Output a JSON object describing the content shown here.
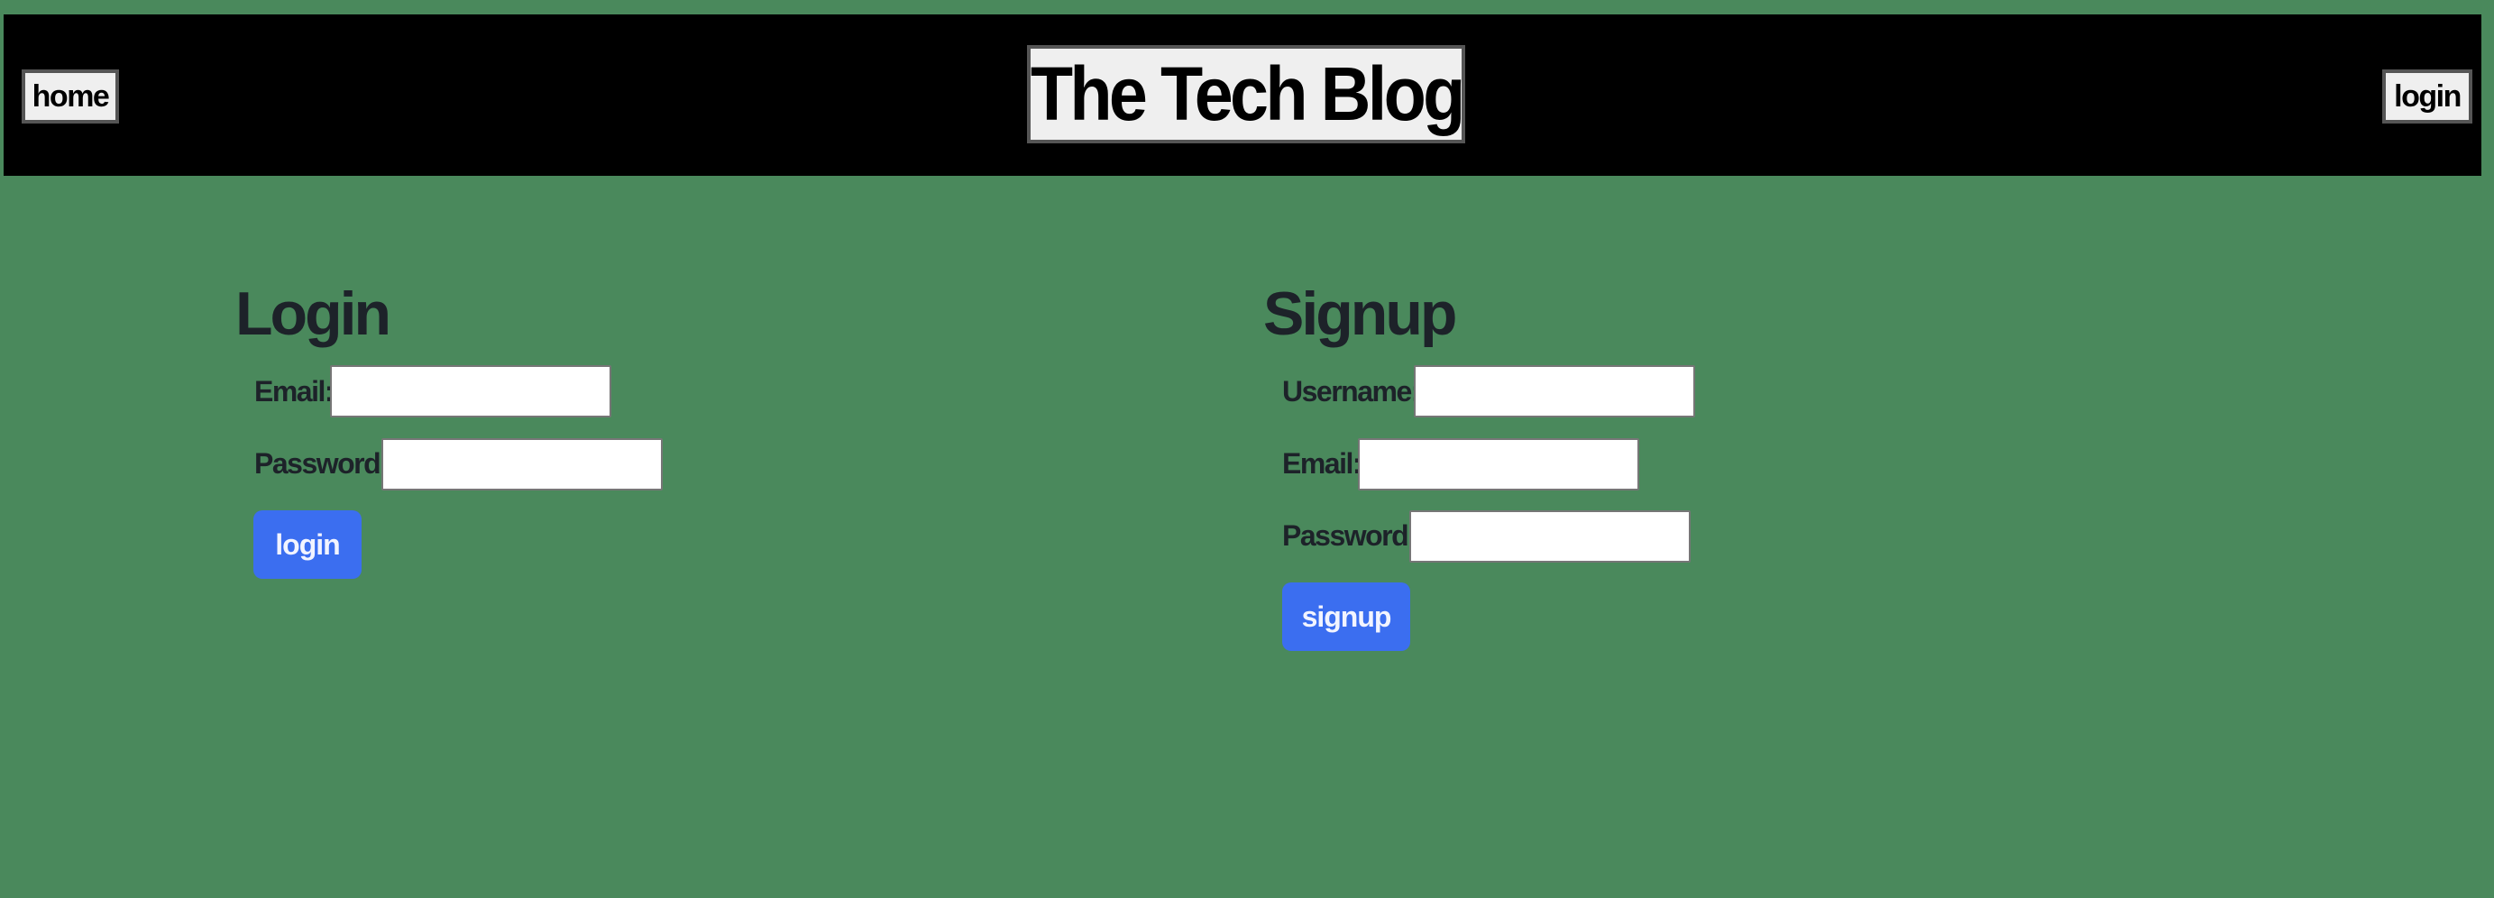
{
  "header": {
    "home_label": "home",
    "title": "The Tech Blog",
    "login_label": "login"
  },
  "login_form": {
    "heading": "Login",
    "email_label": "Email:",
    "email_value": "",
    "password_label": "Password:",
    "password_value": "",
    "submit_label": "login"
  },
  "signup_form": {
    "heading": "Signup",
    "username_label": "Username:",
    "username_value": "",
    "email_label": "Email:",
    "email_value": "",
    "password_label": "Password:",
    "password_value": "",
    "submit_label": "signup"
  },
  "colors": {
    "page_background": "#4a895c",
    "header_background": "#000000",
    "button_accent": "#3b6ef0",
    "text": "#1d2229"
  }
}
